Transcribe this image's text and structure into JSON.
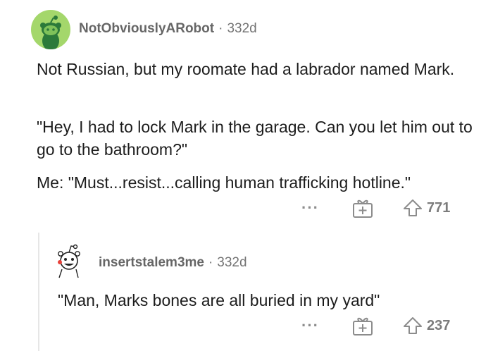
{
  "comment1": {
    "username": "NotObviouslyARobot",
    "separator": "·",
    "age": "332d",
    "paragraphs": [
      "Not Russian, but my roomate had a labrador named Mark.",
      "\"Hey, I had to lock Mark in the garage.  Can you let him out to go to the bathroom?\"",
      "Me:  \"Must...resist...calling human trafficking hotline.\""
    ],
    "more": "···",
    "gift_icon": "gift-icon",
    "upvote_icon": "upvote-arrow-icon",
    "votes": "771",
    "avatar_color": "#a4d76b"
  },
  "reply1": {
    "username": "insertstalem3me",
    "separator": "·",
    "age": "332d",
    "text": "\"Man, Marks bones are all buried in my yard\"",
    "more": "···",
    "gift_icon": "gift-icon",
    "upvote_icon": "upvote-arrow-icon",
    "votes": "237"
  }
}
